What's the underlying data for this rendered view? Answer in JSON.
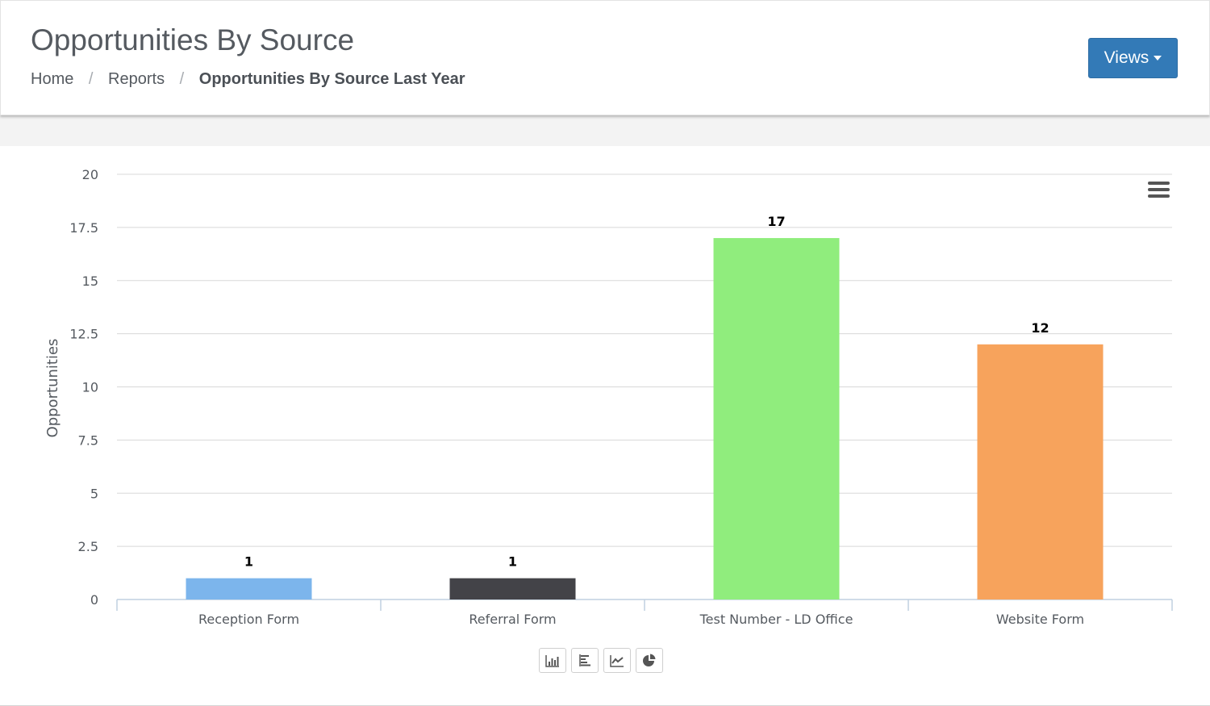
{
  "header": {
    "title": "Opportunities By Source",
    "breadcrumb": [
      {
        "label": "Home"
      },
      {
        "label": "Reports"
      },
      {
        "label": "Opportunities By Source Last Year"
      }
    ],
    "views_button": "Views"
  },
  "chart_data": {
    "type": "bar",
    "categories": [
      "Reception Form",
      "Referral Form",
      "Test Number - LD Office",
      "Website Form"
    ],
    "values": [
      1,
      1,
      17,
      12
    ],
    "colors": [
      "#7cb5ec",
      "#434348",
      "#90ed7d",
      "#f7a35c"
    ],
    "ylabel": "Opportunities",
    "xlabel": "",
    "ylim": [
      0,
      20
    ],
    "yticks": [
      "0",
      "2.5",
      "5",
      "7.5",
      "10",
      "12.5",
      "15",
      "17.5",
      "20"
    ],
    "data_labels": true,
    "legend": "none",
    "grid": true
  },
  "chart_controls": {
    "menu_icon": "hamburger-menu-icon",
    "type_buttons": [
      {
        "icon": "bar-chart-icon"
      },
      {
        "icon": "horizontal-bar-chart-icon"
      },
      {
        "icon": "line-chart-icon"
      },
      {
        "icon": "pie-chart-icon"
      }
    ]
  }
}
